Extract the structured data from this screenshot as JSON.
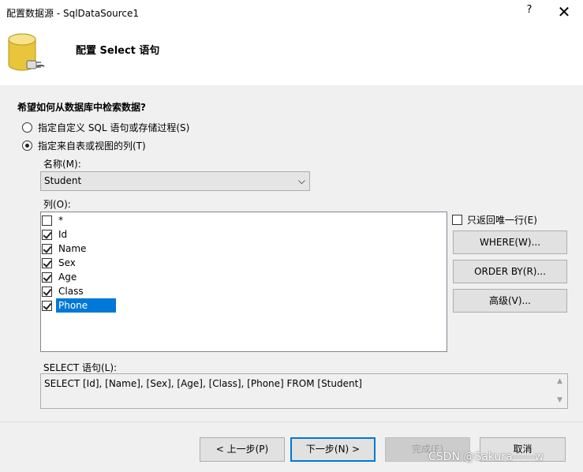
{
  "window": {
    "title": "配置数据源 - SqlDataSource1",
    "help_label": "?",
    "close_label": "✕"
  },
  "header": {
    "heading": "配置 Select 语句"
  },
  "retrieval": {
    "question": "希望如何从数据库中检索数据?",
    "option_custom": "指定自定义 SQL 语句或存储过程(S)",
    "option_columns": "指定来自表或视图的列(T)",
    "selected_option": "columns"
  },
  "name_field": {
    "label": "名称(M):",
    "value": "Student",
    "chevron": "⌵"
  },
  "columns": {
    "label": "列(O):",
    "items": [
      {
        "label": "*",
        "checked": false
      },
      {
        "label": "Id",
        "checked": true
      },
      {
        "label": "Name",
        "checked": true
      },
      {
        "label": "Sex",
        "checked": true
      },
      {
        "label": "Age",
        "checked": true
      },
      {
        "label": "Class",
        "checked": true
      },
      {
        "label": "Phone",
        "checked": true
      }
    ],
    "selected_item": "Phone"
  },
  "options": {
    "unique_label": "只返回唯一行(E)",
    "unique_checked": false,
    "where_label": "WHERE(W)...",
    "orderby_label": "ORDER BY(R)...",
    "advanced_label": "高级(V)..."
  },
  "sql": {
    "label": "SELECT 语句(L):",
    "value": "SELECT [Id], [Name], [Sex], [Age], [Class], [Phone] FROM [Student]",
    "scroll_up": "▲",
    "scroll_down": "▼"
  },
  "footer": {
    "back_label": "< 上一步(P)",
    "next_label": "下一步(N) >",
    "finish_label": "完成(F)",
    "cancel_label": "取消"
  },
  "watermark": "CSDN @Sakura——w",
  "colors": {
    "selection": "#0078d7",
    "db_icon_yellow": "#e8c53a",
    "primary_border": "#0078d7"
  }
}
